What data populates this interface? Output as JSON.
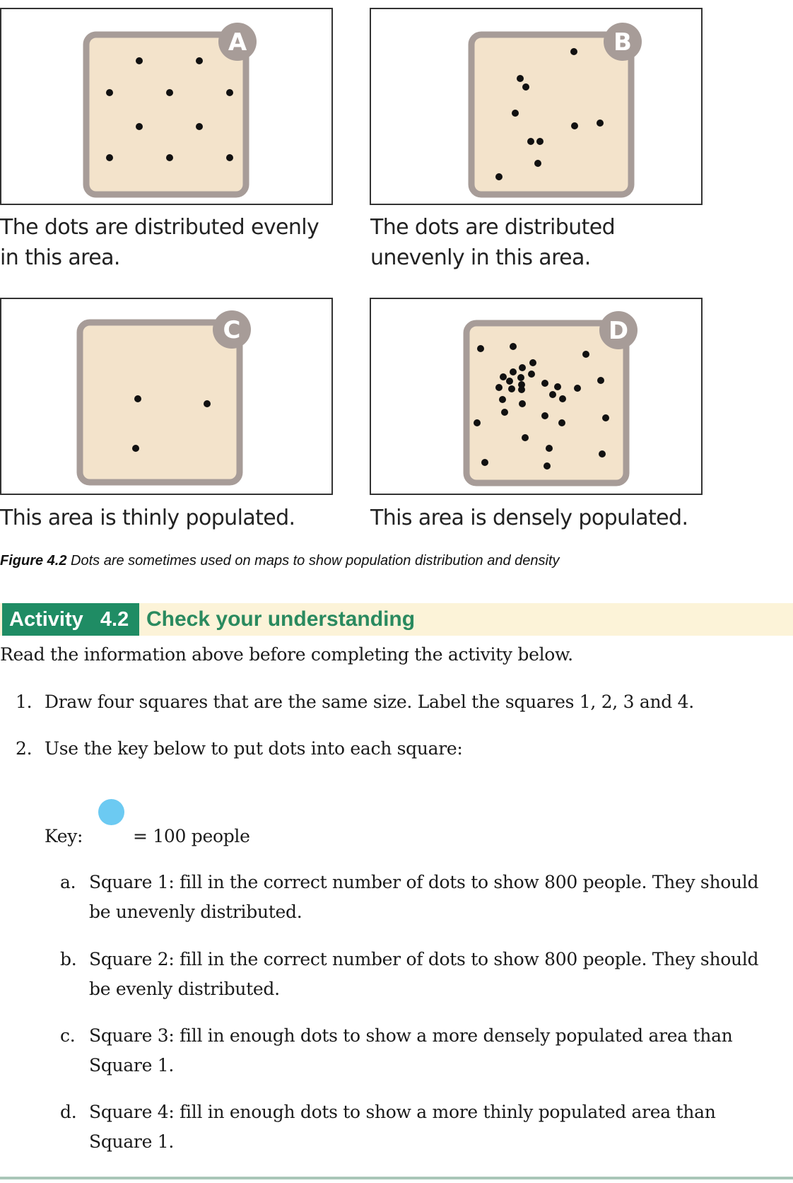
{
  "figure": {
    "panels": [
      {
        "label": "A",
        "caption_lines": [
          "The dots are distributed evenly",
          "in this area."
        ],
        "dot_count": 10,
        "distribution": "even"
      },
      {
        "label": "B",
        "caption_lines": [
          "The dots are distributed",
          "unevenly in this area."
        ],
        "dot_count": 10,
        "distribution": "uneven"
      },
      {
        "label": "C",
        "caption_lines": [
          "This area is thinly populated."
        ],
        "dot_count": 3,
        "density": "thin"
      },
      {
        "label": "D",
        "caption_lines": [
          "This area is densely populated."
        ],
        "dot_count": 33,
        "density": "dense"
      }
    ],
    "caption_label": "Figure 4.2",
    "caption_text": " Dots are sometimes used on maps to show population distribution and density"
  },
  "activity": {
    "tag": "Activity   4.2",
    "title": "Check your understanding",
    "intro": "Read the information above before completing the activity below.",
    "steps": [
      {
        "num": "1.",
        "text": "Draw four squares that are the same size. Label the squares 1, 2, 3 and 4."
      },
      {
        "num": "2.",
        "text": "Use the key below to put dots into each square:"
      }
    ],
    "key": {
      "label": "Key:",
      "value": "= 100 people",
      "dot_color": "#6ccaf2"
    },
    "subitems": [
      {
        "letter": "a.",
        "lines": [
          "Square 1: fill in the correct number of dots to show 800 people. They should",
          "be unevenly distributed."
        ]
      },
      {
        "letter": "b.",
        "lines": [
          "Square 2: fill in the correct number of dots to show 800 people. They should",
          "be evenly distributed."
        ]
      },
      {
        "letter": "c.",
        "lines": [
          "Square 3: fill in enough dots to show a more densely populated area than",
          "Square 1."
        ]
      },
      {
        "letter": "d.",
        "lines": [
          "Square 4: fill in enough dots to show a more thinly populated area than",
          "Square 1."
        ]
      }
    ]
  },
  "colors": {
    "accent_green": "#1f8c64",
    "title_green": "#2a8a5f",
    "banner_bg": "#fcf3d8",
    "map_fill": "#f3e3cb",
    "map_border": "#a79c98"
  }
}
